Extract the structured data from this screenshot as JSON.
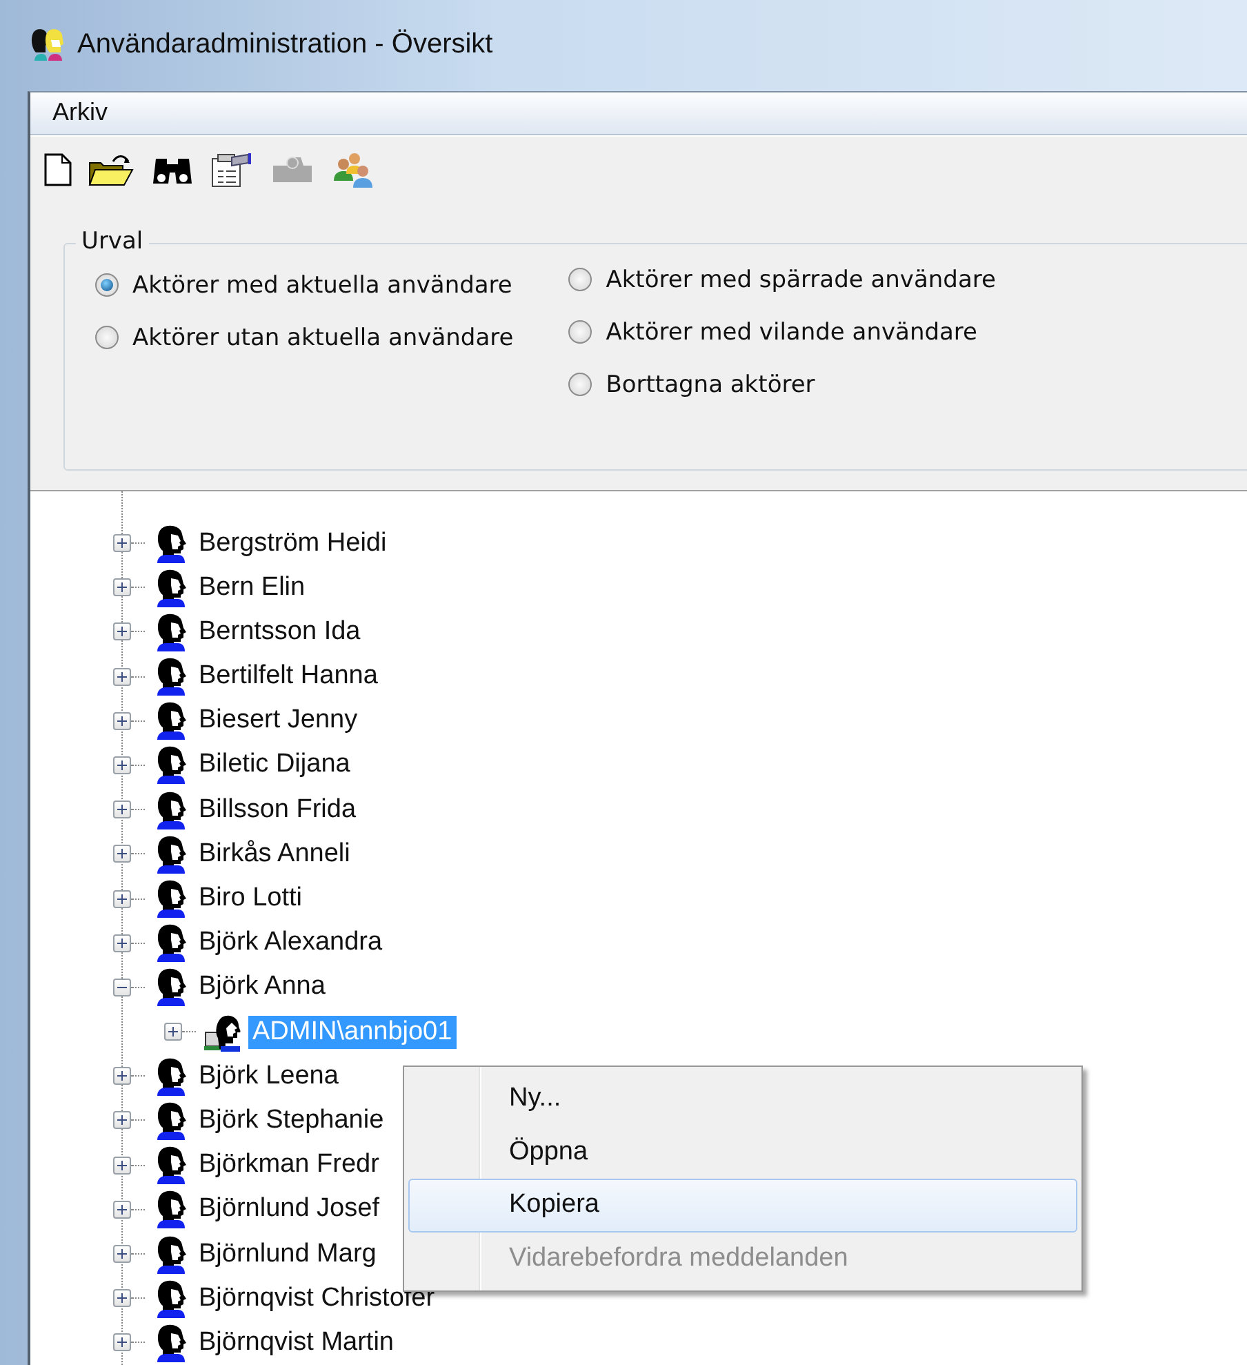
{
  "window": {
    "title": "Användaradministration - Översikt"
  },
  "menu_bar": [
    {
      "label": "Arkiv"
    }
  ],
  "toolbar": [
    {
      "kind": "new",
      "disabled": false
    },
    {
      "kind": "open",
      "disabled": false
    },
    {
      "kind": "find",
      "disabled": false
    },
    {
      "kind": "properties",
      "disabled": false
    },
    {
      "kind": "transfer",
      "disabled": true
    },
    {
      "kind": "users",
      "disabled": false
    }
  ],
  "filter": {
    "title": "Urval",
    "columns": [
      [
        {
          "label": "Aktörer med aktuella användare",
          "selected": true
        },
        {
          "label": "Aktörer utan aktuella användare",
          "selected": false
        }
      ],
      [
        {
          "label": "Aktörer med spärrade användare",
          "selected": false
        },
        {
          "label": "Aktörer med vilande användare",
          "selected": false
        },
        {
          "label": "Borttagna aktörer",
          "selected": false
        }
      ]
    ]
  },
  "tree": {
    "items": [
      {
        "label": "Bergström Heidi",
        "kind": "actor",
        "expanded": false,
        "selected": false
      },
      {
        "label": "Bern Elin",
        "kind": "actor",
        "expanded": false,
        "selected": false
      },
      {
        "label": "Berntsson Ida",
        "kind": "actor",
        "expanded": false,
        "selected": false
      },
      {
        "label": "Bertilfelt Hanna",
        "kind": "actor",
        "expanded": false,
        "selected": false
      },
      {
        "label": "Biesert Jenny",
        "kind": "actor",
        "expanded": false,
        "selected": false
      },
      {
        "label": "Biletic Dijana",
        "kind": "actor",
        "expanded": false,
        "selected": false
      },
      {
        "label": "Billsson Frida",
        "kind": "actor",
        "expanded": false,
        "selected": false
      },
      {
        "label": "Birkås Anneli",
        "kind": "actor",
        "expanded": false,
        "selected": false
      },
      {
        "label": "Biro Lotti",
        "kind": "actor",
        "expanded": false,
        "selected": false
      },
      {
        "label": "Björk Alexandra",
        "kind": "actor",
        "expanded": false,
        "selected": false
      },
      {
        "label": "Björk Anna",
        "kind": "actor",
        "expanded": true,
        "selected": false,
        "children": [
          {
            "label": "ADMIN\\annbjo01",
            "kind": "user",
            "expanded": false,
            "selected": true
          }
        ]
      },
      {
        "label": "Björk Leena",
        "kind": "actor",
        "expanded": false,
        "selected": false
      },
      {
        "label": "Björk Stephanie",
        "kind": "actor",
        "expanded": false,
        "selected": false
      },
      {
        "label": "Björkman Fredr",
        "kind": "actor",
        "expanded": false,
        "selected": false
      },
      {
        "label": "Björnlund Josef",
        "kind": "actor",
        "expanded": false,
        "selected": false
      },
      {
        "label": "Björnlund Marg",
        "kind": "actor",
        "expanded": false,
        "selected": false
      },
      {
        "label": "Björnqvist Christofer",
        "kind": "actor",
        "expanded": false,
        "selected": false
      },
      {
        "label": "Björnqvist Martin",
        "kind": "actor",
        "expanded": false,
        "selected": false
      }
    ]
  },
  "context_menu": {
    "items": [
      {
        "label": "Ny...",
        "highlighted": false,
        "disabled": false
      },
      {
        "label": "Öppna",
        "highlighted": false,
        "disabled": false
      },
      {
        "label": "Kopiera",
        "highlighted": true,
        "disabled": false
      },
      {
        "label": "Vidarebefordra meddelanden",
        "highlighted": false,
        "disabled": true
      }
    ]
  }
}
